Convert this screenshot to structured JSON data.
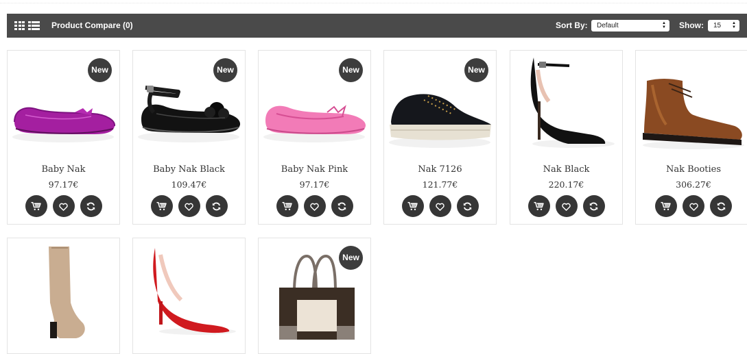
{
  "toolbar": {
    "compare_label": "Product Compare (0)",
    "sort_label": "Sort By:",
    "sort_value": "Default",
    "show_label": "Show:",
    "show_value": "15"
  },
  "badge_text": "New",
  "products": [
    {
      "name": "Baby Nak",
      "price": "97.17€",
      "new": true,
      "image": "pink-glitter-flat"
    },
    {
      "name": "Baby Nak Black",
      "price": "109.47€",
      "new": true,
      "image": "black-mary-jane"
    },
    {
      "name": "Baby Nak Pink",
      "price": "97.17€",
      "new": true,
      "image": "pink-ballerina"
    },
    {
      "name": "Nak 7126",
      "price": "121.77€",
      "new": true,
      "image": "black-sneaker"
    },
    {
      "name": "Nak Black",
      "price": "220.17€",
      "new": false,
      "image": "black-ankle-strap-heel"
    },
    {
      "name": "Nak Booties",
      "price": "306.27€",
      "new": false,
      "image": "brown-chukka-boot"
    },
    {
      "name": "",
      "price": "",
      "new": false,
      "image": "beige-knee-boot"
    },
    {
      "name": "",
      "price": "",
      "new": false,
      "image": "red-pump"
    },
    {
      "name": "",
      "price": "",
      "new": true,
      "image": "brown-tote-bag"
    }
  ],
  "colors": {
    "toolbar_bg": "#4a4a4a",
    "button_bg": "#363636",
    "badge_bg": "#3d3d3d",
    "text": "#333333"
  }
}
